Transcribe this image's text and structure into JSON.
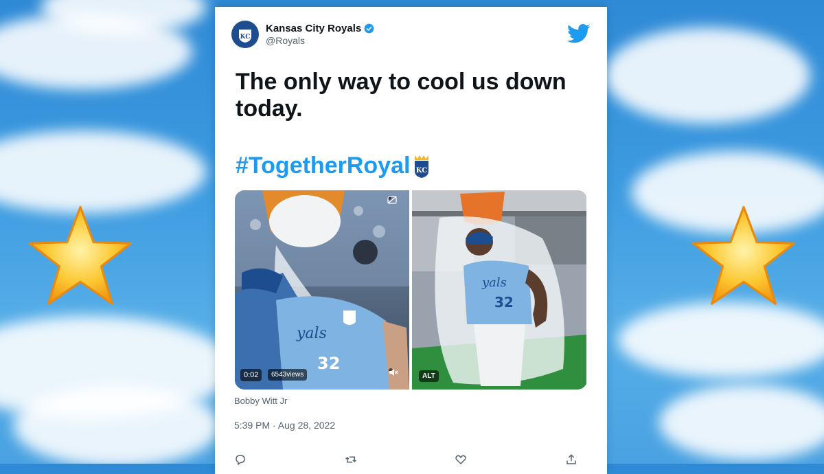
{
  "tweet": {
    "account_name": "Kansas City Royals",
    "handle": "@Royals",
    "text": "The only way to cool us down today.",
    "hashtag": "#TogetherRoyal",
    "media": {
      "video_time": "0:02",
      "video_views": "6543views",
      "alt_badge": "ALT"
    },
    "caption": "Bobby Witt Jr",
    "timestamp": "5:39 PM · Aug 28, 2022"
  },
  "icons": [
    "twitter-logo-icon",
    "verified-icon",
    "kc-badge-icon",
    "muted-icon",
    "captions-off-icon",
    "reply-icon",
    "retweet-icon",
    "like-icon",
    "share-icon",
    "star-icon"
  ],
  "colors": {
    "twitter_blue": "#1d9bf0",
    "royals_blue": "#1d4c8f",
    "star_gold": "#f7b51e"
  }
}
